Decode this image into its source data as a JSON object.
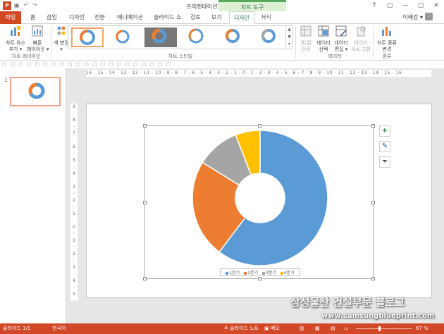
{
  "titlebar": {
    "app_icon": "P",
    "doc_title": "프레젠테이션3 - PowerPoint",
    "context_tab_title": "차트 도구",
    "win_controls": [
      "?",
      "▢",
      "—",
      "▢",
      "✕"
    ]
  },
  "tabs": [
    "파일",
    "홈",
    "삽입",
    "디자인",
    "전환",
    "애니메이션",
    "슬라이드 쇼",
    "검토",
    "보기",
    "디자인",
    "서식"
  ],
  "user_name": "이혜강 ▾",
  "ribbon": {
    "add_element": "차트 요소\n추가 ▾",
    "quick_layout": "빠른\n레이아웃 ▾",
    "layout_group": "차트 레이아웃",
    "change_color": "색 변경\n▾",
    "style_group": "차트 스타일",
    "switch_row_col": "행/열\n전환",
    "select_data": "데이터\n선택",
    "edit_data": "데이터\n편집 ▾",
    "refresh_data": "데이터\n새로 고침",
    "data_group": "데이터",
    "change_type": "차트 종류\n변경",
    "type_group": "종류"
  },
  "hruler": "16 · 15 · 14 · 13 · 12 · 11 · 10 · 9 · 8 · 7 · 6 · 5 · 4 · 3 · 2 · 1 · 0 · 1 · 2 · 3 · 4 · 5 · 6 · 7 · 8 · 9 · 10 · 11 · 12 · 13 · 14 · 15 · 16",
  "vruler": [
    "9",
    "·",
    "8",
    "·",
    "7",
    "·",
    "6",
    "·",
    "5",
    "·",
    "4",
    "·",
    "3",
    "·",
    "2",
    "·",
    "1",
    "·",
    "0",
    "·",
    "1",
    "·",
    "2",
    "·",
    "3",
    "·",
    "4",
    "·",
    "5",
    "·",
    "6"
  ],
  "slide_number": "1",
  "chart_data": {
    "type": "pie",
    "subtype": "doughnut",
    "categories": [
      "1분기",
      "2분기",
      "3분기",
      "4분기"
    ],
    "values": [
      8.2,
      3.2,
      1.4,
      0.8
    ],
    "colors": [
      "#5b9bd5",
      "#ed7d31",
      "#a5a5a5",
      "#ffc000"
    ],
    "title": "",
    "legend": "bottom"
  },
  "statusbar": {
    "slide_info": "슬라이드 1/1",
    "language": "한국어",
    "notes": "≜ 슬라이드 노트",
    "comments": "▣ 메모",
    "zoom": "67 %"
  },
  "watermark": {
    "text": "삼성물산 건설부문 블로그",
    "url": "www.samsungblueprint.com"
  }
}
